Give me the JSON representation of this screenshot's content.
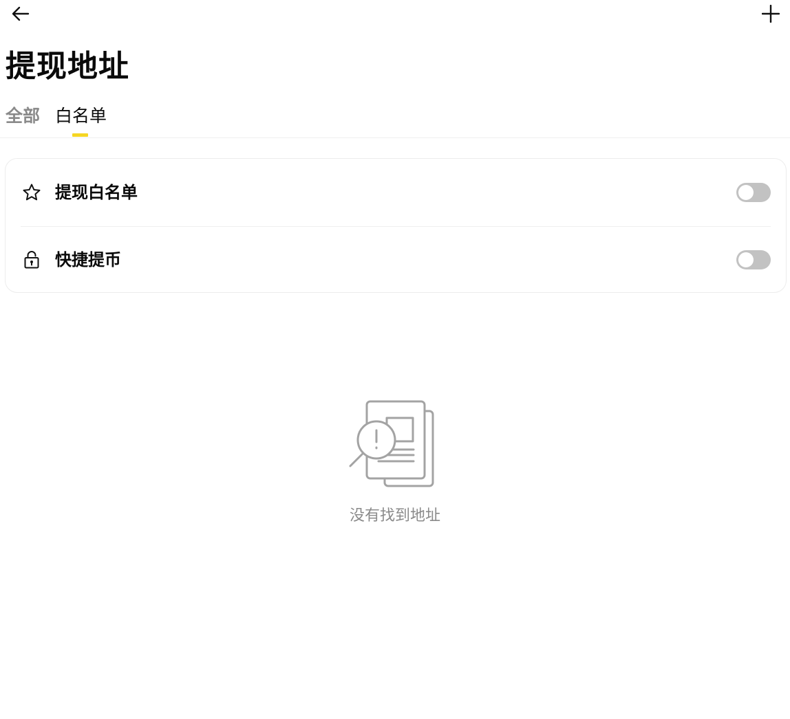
{
  "header": {
    "back_icon": "arrow-left-icon",
    "add_icon": "plus-icon",
    "title": "提现地址"
  },
  "tabs": [
    {
      "label": "全部",
      "active": false
    },
    {
      "label": "白名单",
      "active": true
    }
  ],
  "accent_color": "#f5d623",
  "settings": [
    {
      "icon": "star-icon",
      "label": "提现白名单",
      "enabled": false
    },
    {
      "icon": "unlock-icon",
      "label": "快捷提币",
      "enabled": false
    }
  ],
  "empty_state": {
    "icon": "document-search-alert-icon",
    "message": "没有找到地址"
  }
}
